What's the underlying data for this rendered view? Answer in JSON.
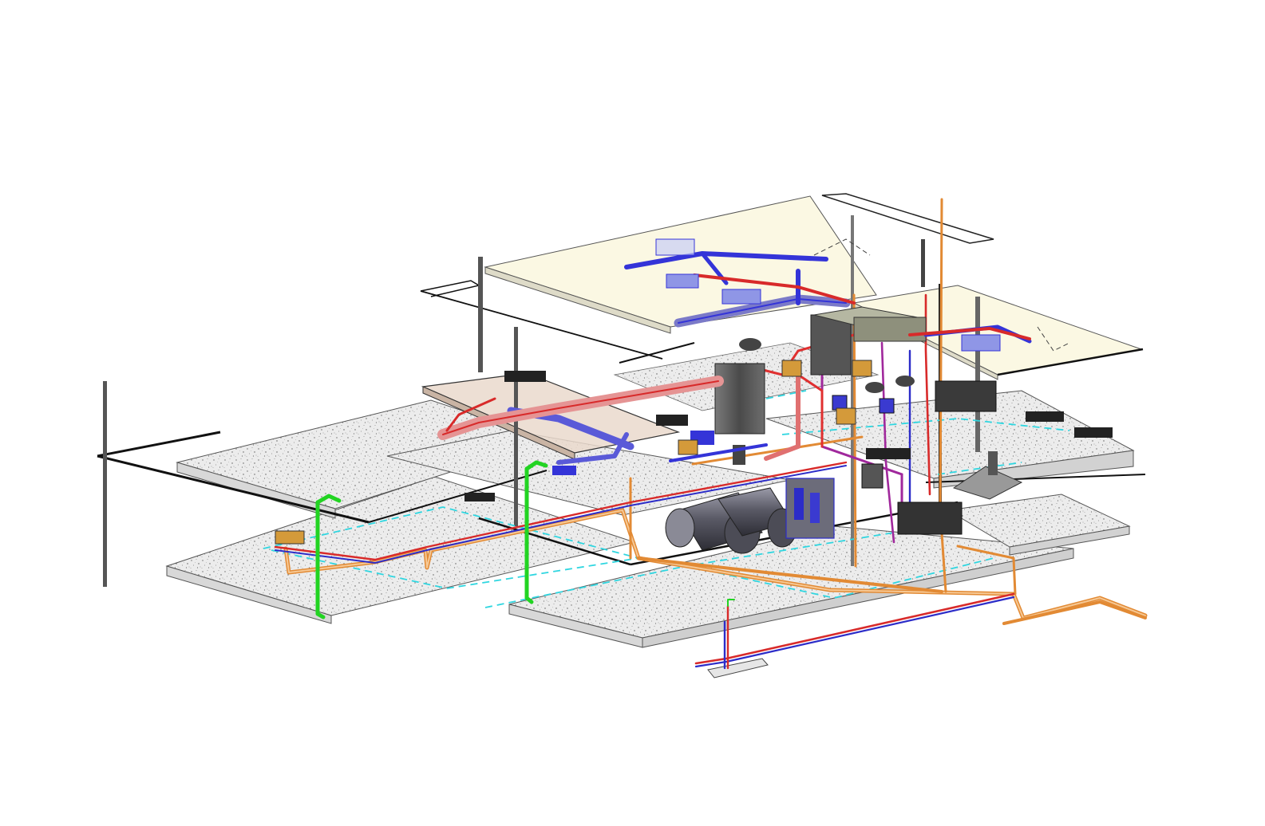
{
  "view": {
    "kind": "isometric-mep-model",
    "background": "#ffffff"
  },
  "colors": {
    "slab_fill": "#e9e9e9",
    "slab_edge": "#555555",
    "roof_fill": "#fbf8e3",
    "mezzanine_fill": "#ead9cc",
    "structure": "#111111",
    "column": "#444444",
    "supply_duct": "#3434d8",
    "supply_duct_light": "#9aa6ef",
    "return_duct": "#d82a2a",
    "hot_water": "#e03030",
    "cold_water": "#2c2cc8",
    "heating_pipe": "#a0289c",
    "drainage": "#e28a34",
    "drainage_light": "#f2c48c",
    "gas_riser": "#22d422",
    "boundary_dashed": "#2fd6e0",
    "equipment": "#555555",
    "equipment_light": "#8a8a8a",
    "fixture": "#d49a3a"
  },
  "components": [
    {
      "id": "roof-slab",
      "icon": "slab"
    },
    {
      "id": "upper-mezzanine",
      "icon": "slab"
    },
    {
      "id": "ground-floor-slab",
      "icon": "slab"
    },
    {
      "id": "basement-slab",
      "icon": "slab"
    },
    {
      "id": "air-handling-unit",
      "icon": "equipment"
    },
    {
      "id": "storage-tanks",
      "icon": "tank"
    },
    {
      "id": "gas-riser",
      "icon": "pipe"
    },
    {
      "id": "drainage-network",
      "icon": "pipe"
    },
    {
      "id": "supply-ductwork",
      "icon": "duct"
    },
    {
      "id": "return-ductwork",
      "icon": "duct"
    }
  ]
}
